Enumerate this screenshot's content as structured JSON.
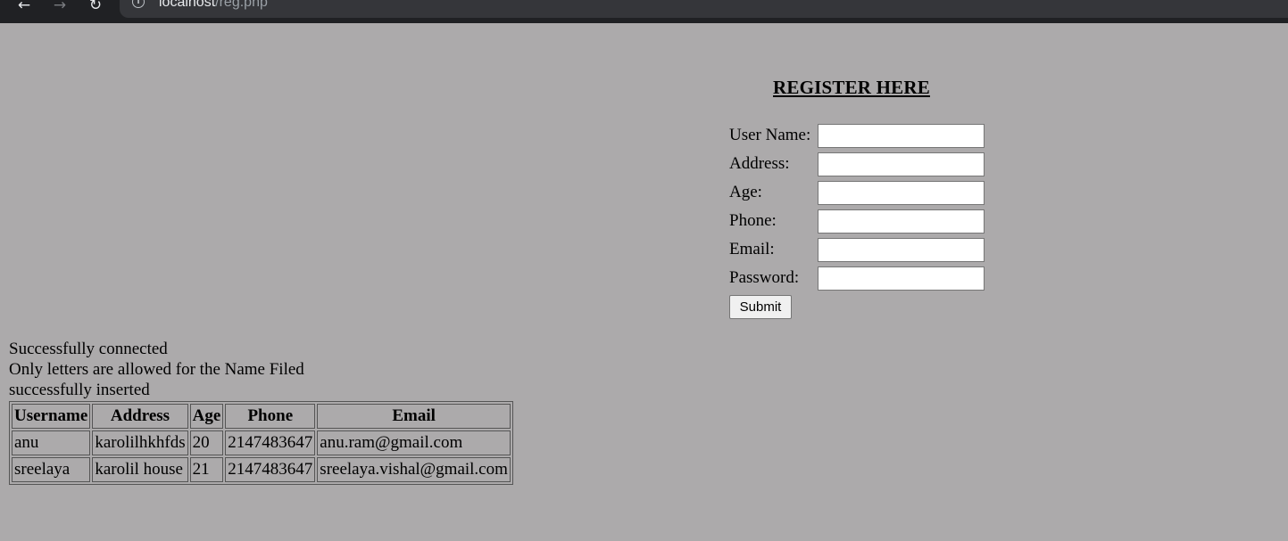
{
  "browser": {
    "url_host": "localhost",
    "url_path": "/reg.php",
    "back_icon": "arrow-left-icon",
    "forward_icon": "arrow-right-icon",
    "reload_icon": "reload-icon",
    "info_icon": "info-icon"
  },
  "form": {
    "heading": "REGISTER HERE",
    "fields": [
      {
        "label": "User Name:",
        "value": ""
      },
      {
        "label": "Address:",
        "value": ""
      },
      {
        "label": "Age:",
        "value": ""
      },
      {
        "label": "Phone:",
        "value": ""
      },
      {
        "label": "Email:",
        "value": ""
      },
      {
        "label": "Password:",
        "value": ""
      }
    ],
    "submit_label": "Submit"
  },
  "messages": [
    "Successfully connected",
    "Only letters are allowed for the Name Filed",
    "successfully inserted"
  ],
  "table": {
    "headers": [
      "Username",
      "Address",
      "Age",
      "Phone",
      "Email"
    ],
    "rows": [
      [
        "anu",
        "karolilhkhfds",
        "20",
        "2147483647",
        "anu.ram@gmail.com"
      ],
      [
        "sreelaya",
        "karolil house",
        "21",
        "2147483647",
        "sreelaya.vishal@gmail.com"
      ]
    ]
  },
  "colors": {
    "page_background": "#acaaab",
    "browser_bar": "#202124"
  }
}
